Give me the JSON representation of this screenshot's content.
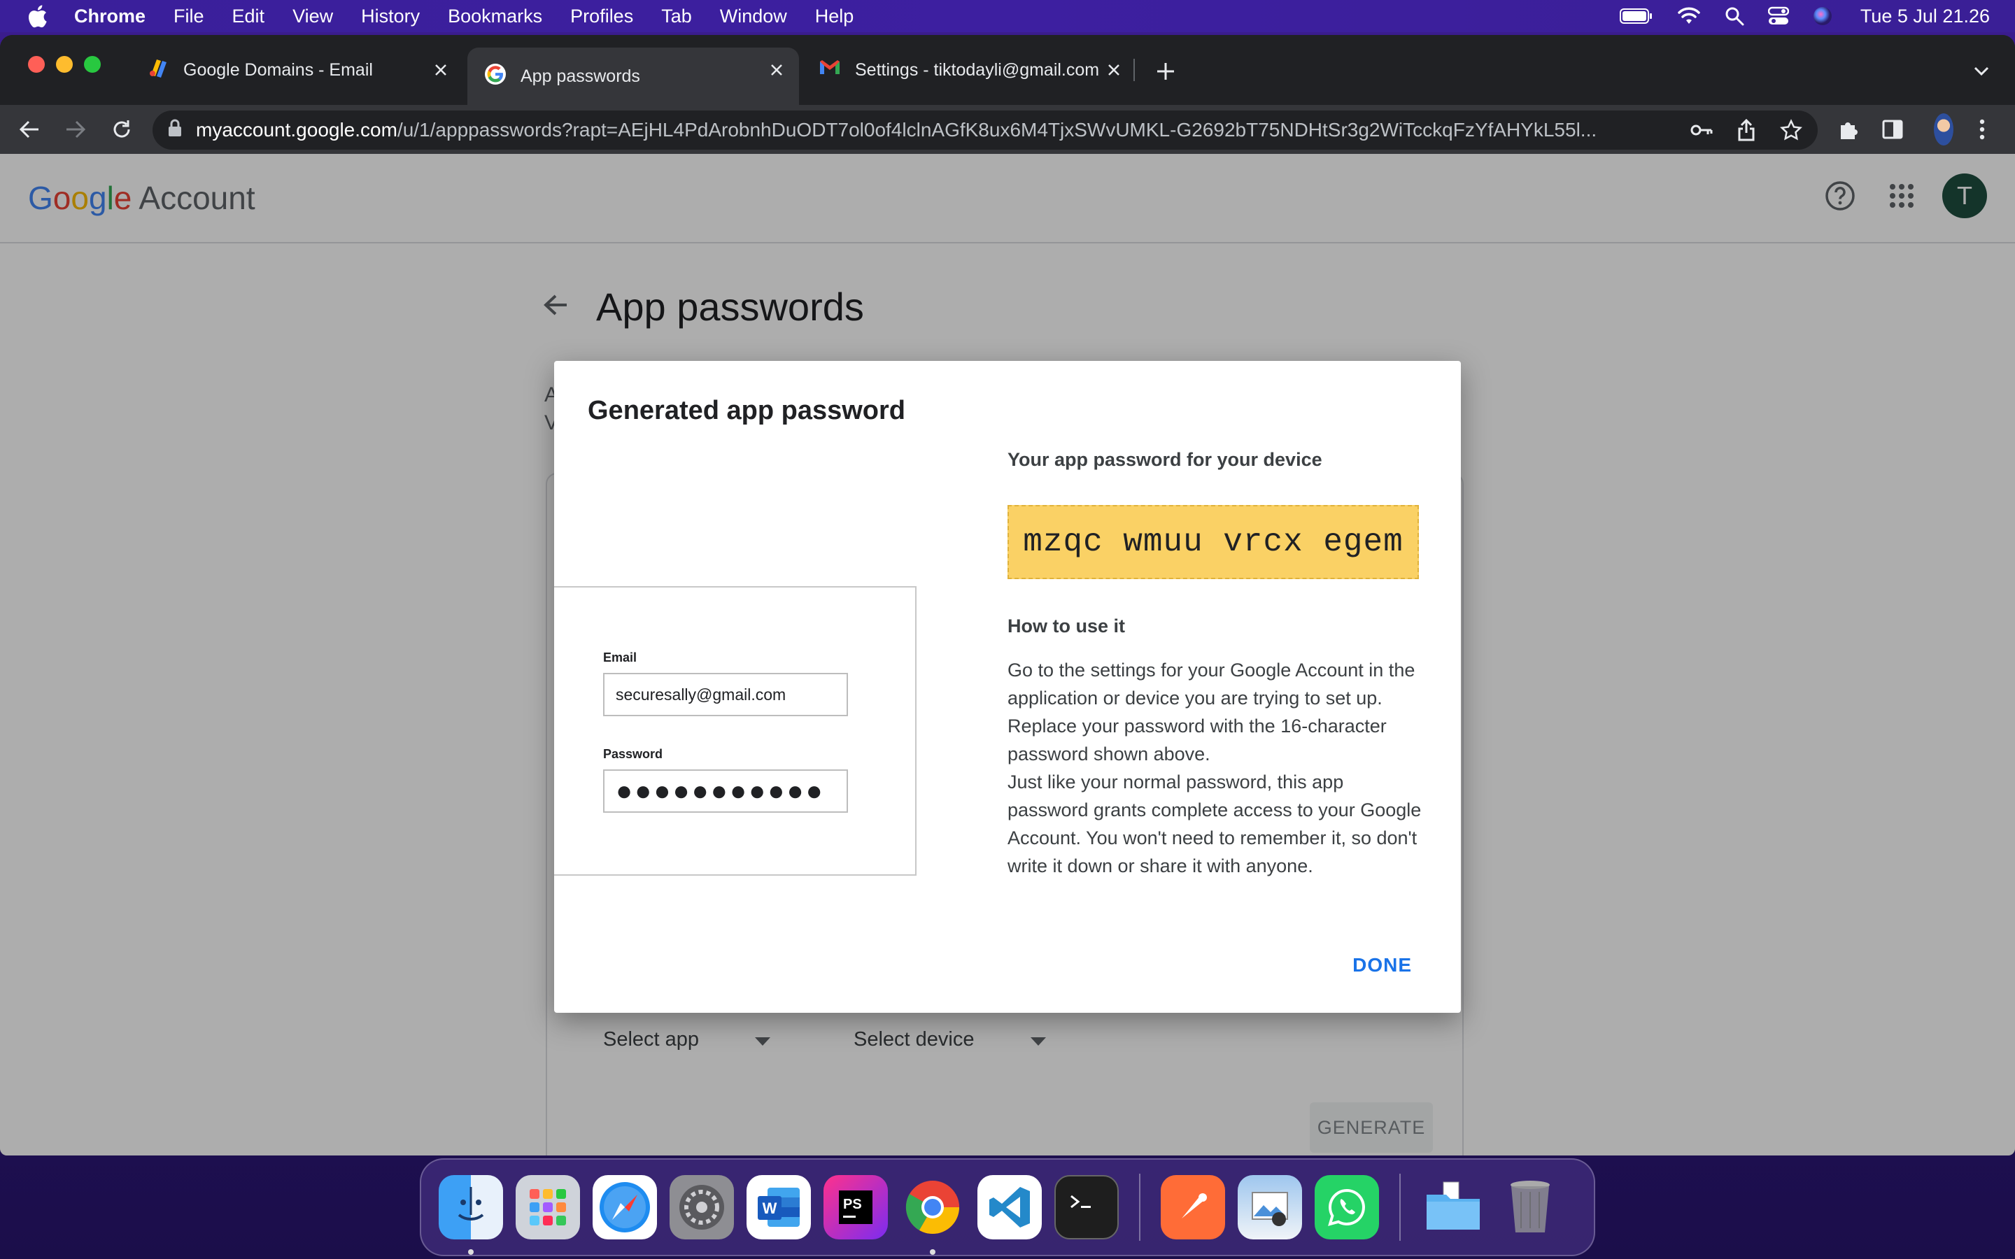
{
  "menubar": {
    "app_name": "Chrome",
    "items": [
      "File",
      "Edit",
      "View",
      "History",
      "Bookmarks",
      "Profiles",
      "Tab",
      "Window",
      "Help"
    ],
    "clock": "Tue 5 Jul  21.26"
  },
  "tabs": [
    {
      "label": "Google Domains - Email",
      "icon": "google-domains-icon"
    },
    {
      "label": "App passwords",
      "icon": "google-g-icon"
    },
    {
      "label": "Settings - tiktodayli@gmail.com",
      "icon": "gmail-icon"
    }
  ],
  "address_bar": {
    "host": "myaccount.google.com",
    "path": "/u/1/apppasswords?rapt=AEjHL4PdArobnhDuODT7ol0of4lclnAGfK8ux6M4TjxSWvUMKL-G2692bT75NDHtSr3g2WiTcckqFzYfAHYkL55l..."
  },
  "google_header": {
    "logo": "Google",
    "product": "Account",
    "avatar_letter": "T"
  },
  "page": {
    "title": "App passwords",
    "bg_fragment_1": "A",
    "bg_fragment_2": "V",
    "select_app": "Select app",
    "select_device": "Select device",
    "generate_label": "GENERATE"
  },
  "dialog": {
    "title": "Generated app password",
    "password_heading": "Your app password for your device",
    "password": "mzqc wmuu vrcx egem",
    "how_heading": "How to use it",
    "how_text_1": "Go to the settings for your Google Account in the application or device you are trying to set up. Replace your password with the 16-character password shown above.",
    "how_text_2": "Just like your normal password, this app password grants complete access to your Google Account. You won't need to remember it, so don't write it down or share it with anyone.",
    "done_label": "DONE",
    "illustration": {
      "email_label": "Email",
      "email_value": "securesally@gmail.com",
      "password_label": "Password",
      "password_value": "●●●●●●●●●●●"
    }
  },
  "dock": [
    "Finder",
    "Launchpad",
    "Safari",
    "System Preferences",
    "Microsoft Word",
    "PhpStorm",
    "Google Chrome",
    "Visual Studio Code",
    "Terminal",
    "Postman",
    "Preview",
    "WhatsApp",
    "Folder",
    "Trash"
  ],
  "colors": {
    "accent": "#1a73e8",
    "password_highlight": "#fad165",
    "avatar": "#1e4d3f"
  }
}
